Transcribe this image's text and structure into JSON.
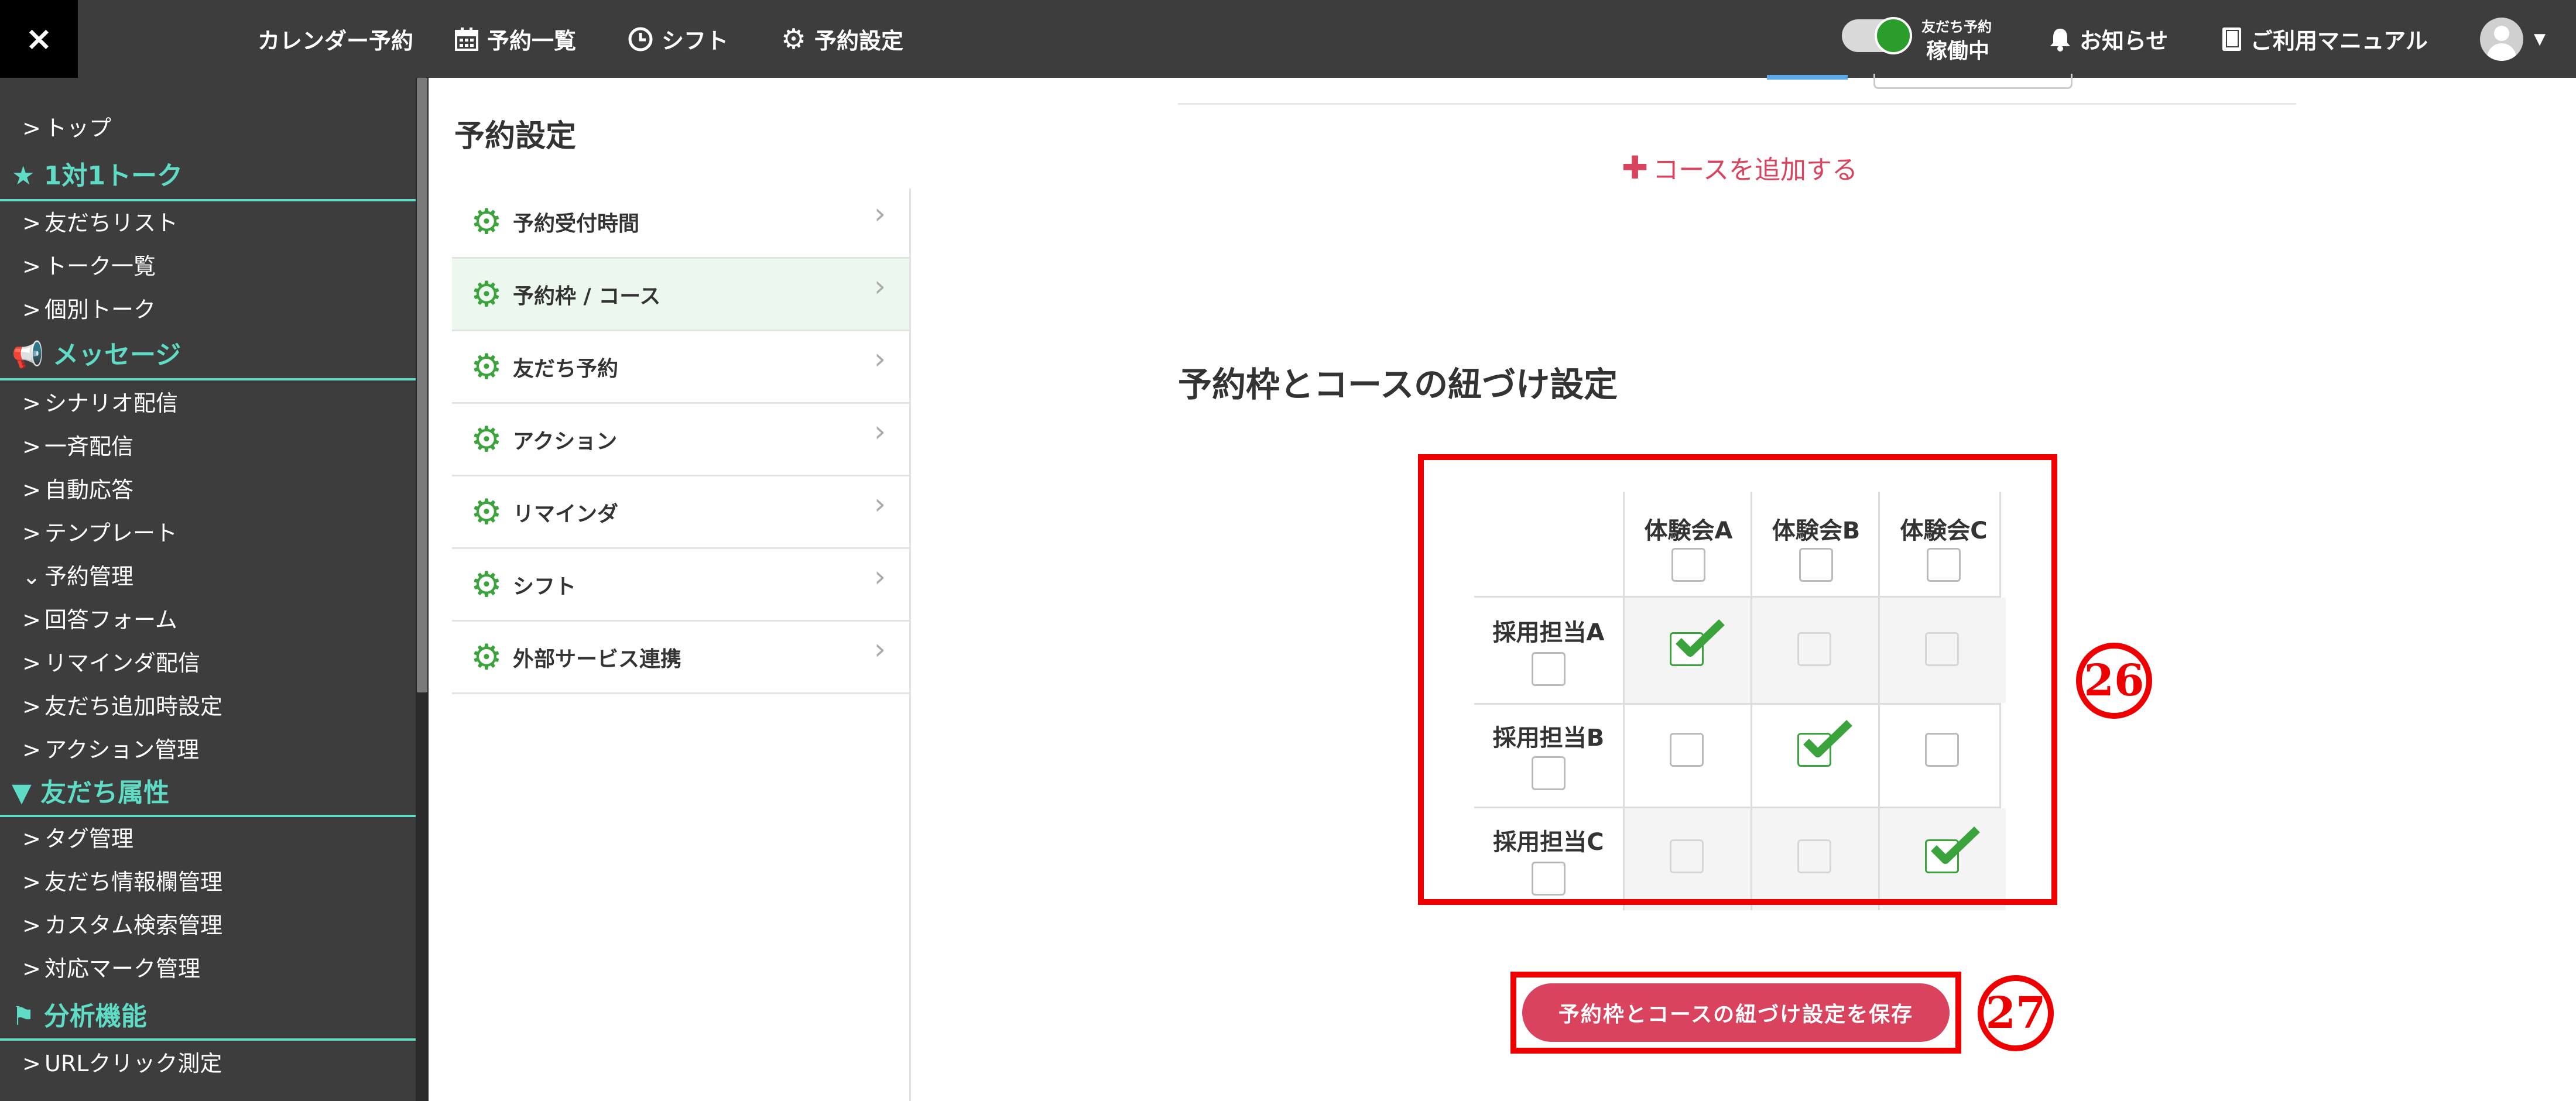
{
  "topbar": {
    "close_icon": "×",
    "nav": [
      {
        "label": "カレンダー予約",
        "icon": ""
      },
      {
        "label": "予約一覧",
        "icon": "calendar-icon"
      },
      {
        "label": "シフト",
        "icon": "clock-icon"
      },
      {
        "label": "予約設定",
        "icon": "gear-icon"
      }
    ],
    "status_small": "友だち予約",
    "status_main": "稼働中",
    "notice": "お知らせ",
    "manual": "ご利用マニュアル"
  },
  "sidebar": {
    "items": [
      {
        "type": "item",
        "label": "トップ"
      },
      {
        "type": "head",
        "label": "1対1トーク",
        "icon": "star-icon"
      },
      {
        "type": "item",
        "label": "友だちリスト"
      },
      {
        "type": "item",
        "label": "トーク一覧"
      },
      {
        "type": "item",
        "label": "個別トーク"
      },
      {
        "type": "head",
        "label": "メッセージ",
        "icon": "megaphone-icon"
      },
      {
        "type": "item",
        "label": "シナリオ配信"
      },
      {
        "type": "item",
        "label": "一斉配信"
      },
      {
        "type": "item",
        "label": "自動応答"
      },
      {
        "type": "item",
        "label": "テンプレート"
      },
      {
        "type": "item",
        "label": "予約管理",
        "expanded": true
      },
      {
        "type": "item",
        "label": "回答フォーム"
      },
      {
        "type": "item",
        "label": "リマインダ配信"
      },
      {
        "type": "item",
        "label": "友だち追加時設定"
      },
      {
        "type": "item",
        "label": "アクション管理"
      },
      {
        "type": "head",
        "label": "友だち属性",
        "icon": "filter-icon"
      },
      {
        "type": "item",
        "label": "タグ管理"
      },
      {
        "type": "item",
        "label": "友だち情報欄管理"
      },
      {
        "type": "item",
        "label": "カスタム検索管理"
      },
      {
        "type": "item",
        "label": "対応マーク管理"
      },
      {
        "type": "head",
        "label": "分析機能",
        "icon": "flag-icon"
      },
      {
        "type": "item",
        "label": "URLクリック測定"
      }
    ]
  },
  "settings": {
    "title": "予約設定",
    "menu": [
      {
        "label": "予約受付時間"
      },
      {
        "label": "予約枠 / コース",
        "active": true
      },
      {
        "label": "友だち予約"
      },
      {
        "label": "アクション"
      },
      {
        "label": "リマインダ"
      },
      {
        "label": "シフト"
      },
      {
        "label": "外部サービス連携"
      }
    ]
  },
  "main": {
    "add_course": "コースを追加する",
    "section_title": "予約枠とコースの紐づけ設定",
    "columns": [
      "体験会A",
      "体験会B",
      "体験会C"
    ],
    "rows": [
      {
        "label": "採用担当A",
        "checks": [
          true,
          false,
          false
        ]
      },
      {
        "label": "採用担当B",
        "checks": [
          false,
          true,
          false
        ]
      },
      {
        "label": "採用担当C",
        "checks": [
          false,
          false,
          true
        ]
      }
    ],
    "save_button": "予約枠とコースの紐づけ設定を保存",
    "annotation_grid": "26",
    "annotation_button": "27"
  },
  "colors": {
    "topbar_bg": "#3d3d3d",
    "accent_teal": "#5fdcc6",
    "check_green": "#3ba33b",
    "button_pink": "#d9435e",
    "annotation_red": "#ee0000"
  }
}
